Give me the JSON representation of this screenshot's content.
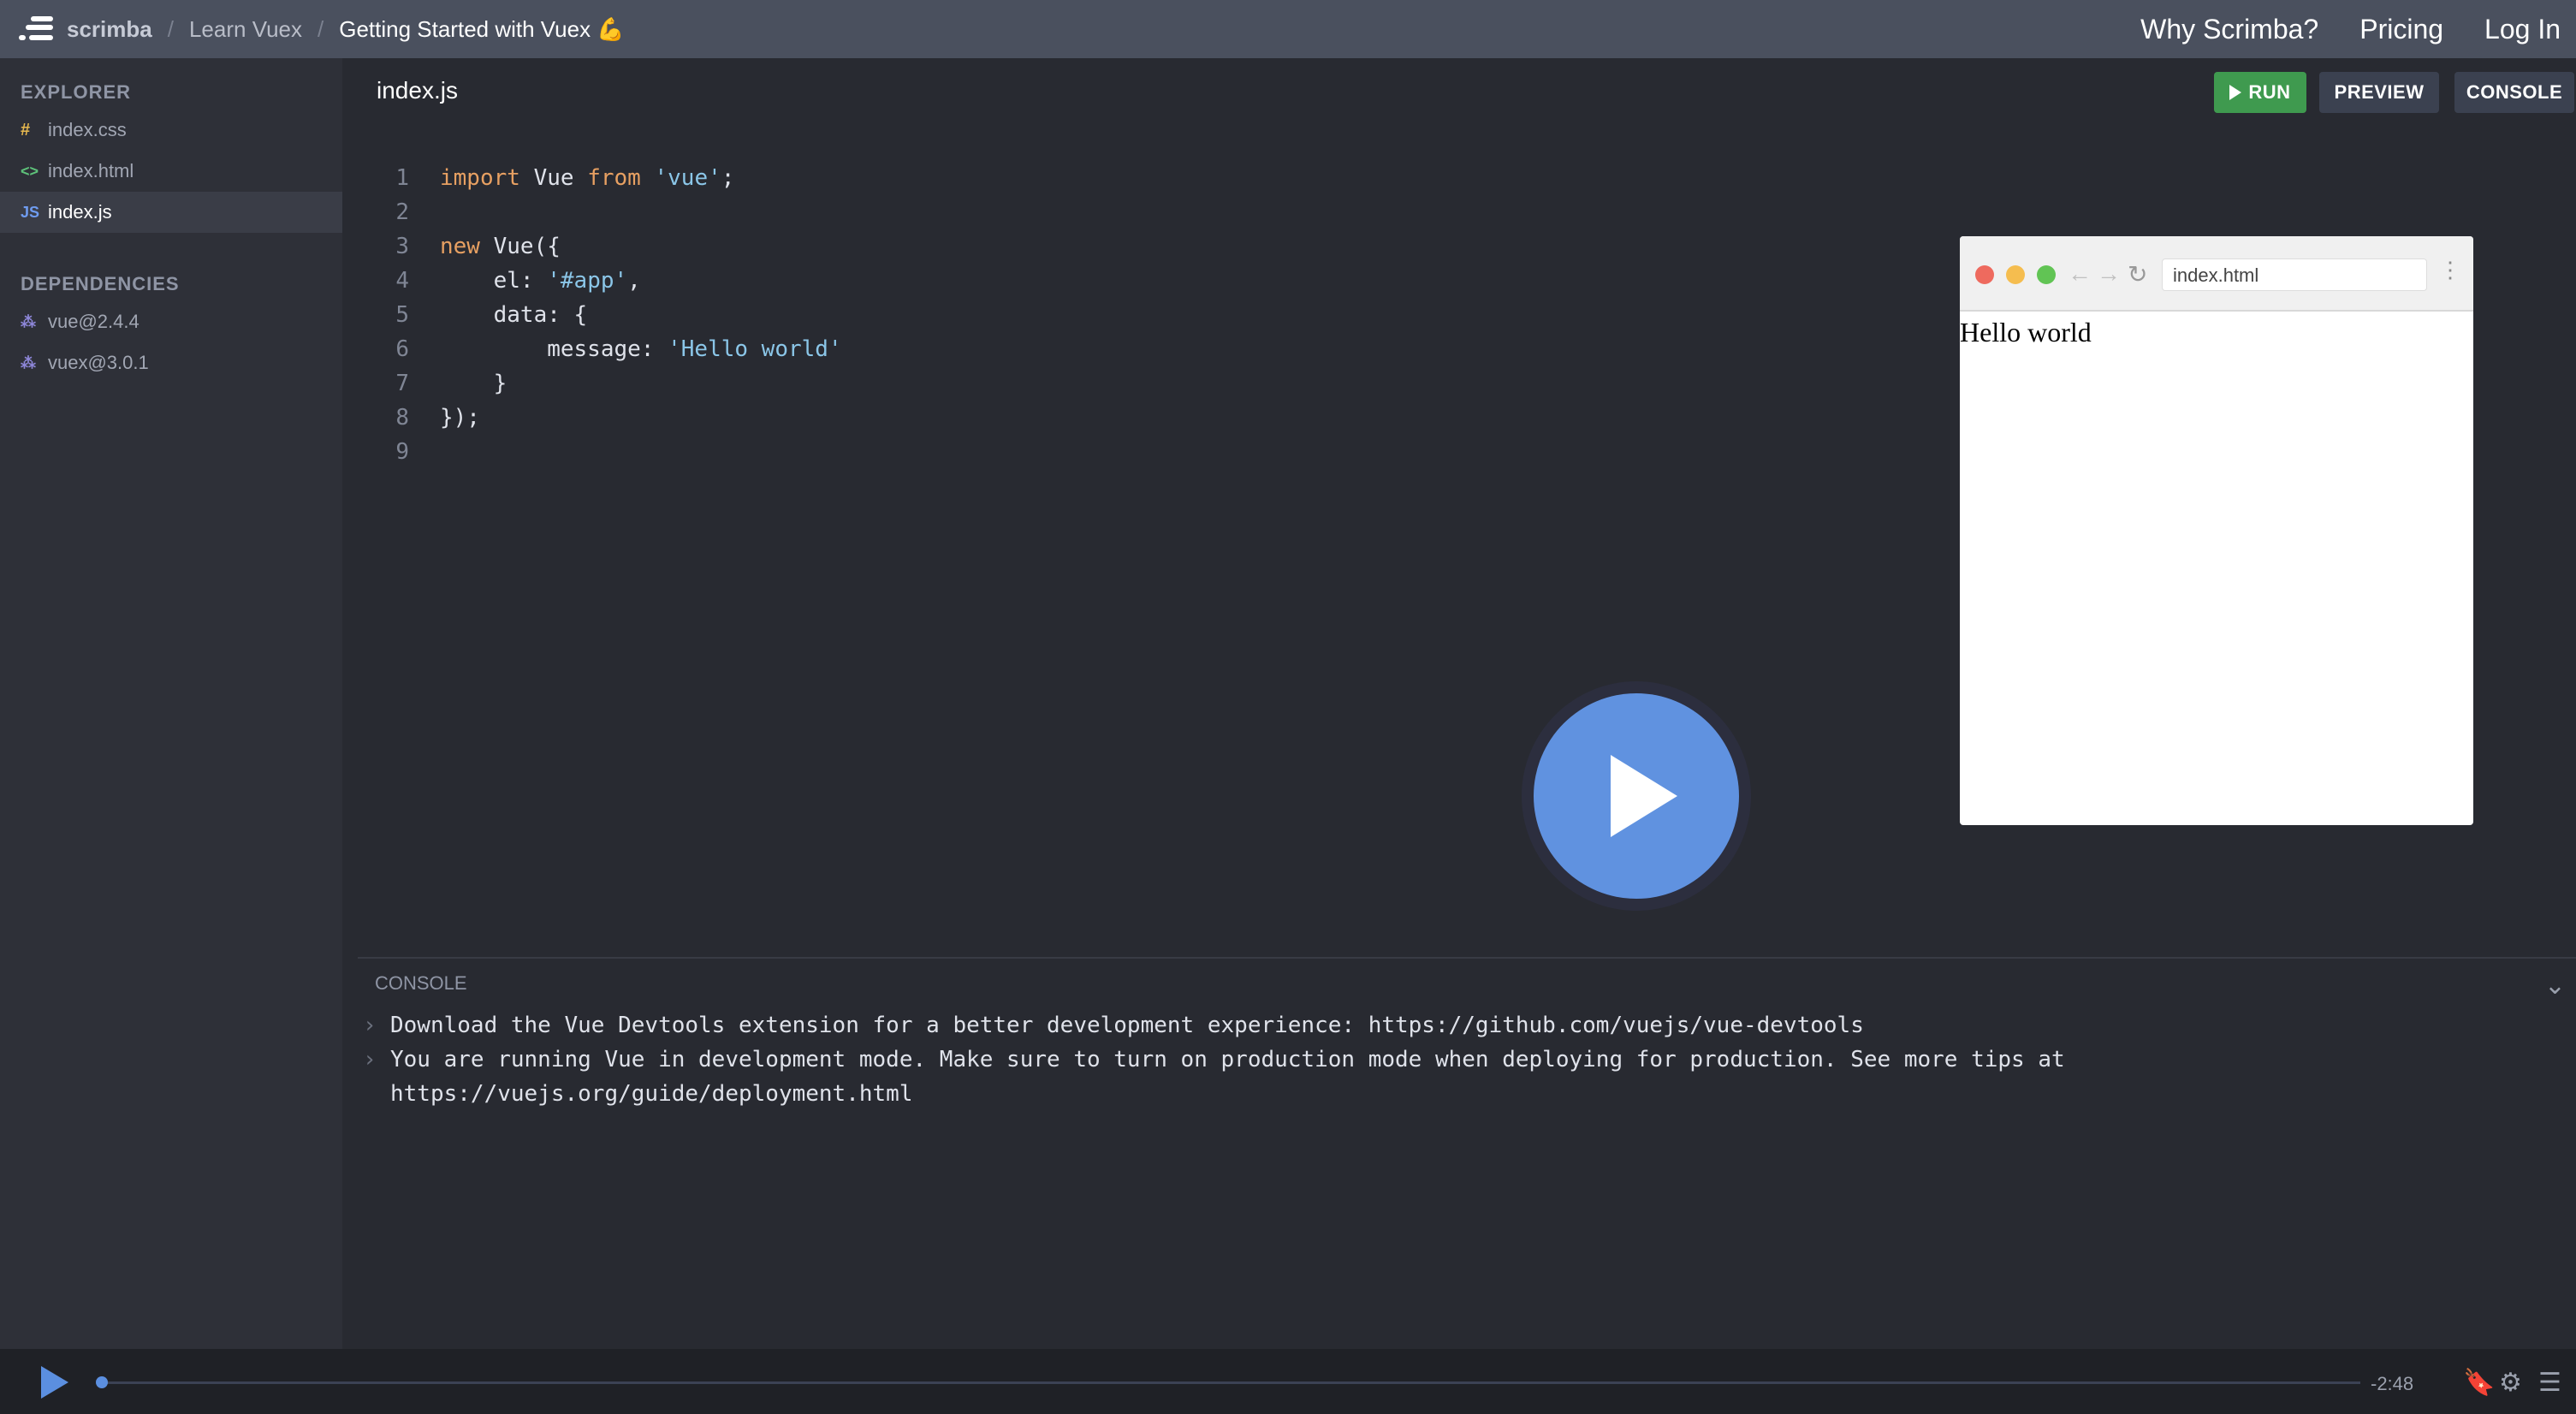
{
  "header": {
    "brand": "scrimba",
    "breadcrumbs": [
      "Learn Vuex",
      "Getting Started with Vuex 💪"
    ],
    "nav": [
      "Why Scrimba?",
      "Pricing",
      "Log In"
    ]
  },
  "sidebar": {
    "explorer_title": "EXPLORER",
    "files": [
      {
        "icon": "#",
        "name": "index.css"
      },
      {
        "icon": "<>",
        "name": "index.html"
      },
      {
        "icon": "JS",
        "name": "index.js"
      }
    ],
    "dependencies_title": "DEPENDENCIES",
    "dependencies": [
      "vue@2.4.4",
      "vuex@3.0.1"
    ]
  },
  "editor": {
    "active_file": "index.js",
    "buttons": {
      "run": "RUN",
      "preview": "PREVIEW",
      "console": "CONSOLE"
    },
    "line_numbers": [
      "1",
      "2",
      "3",
      "4",
      "5",
      "6",
      "7",
      "8",
      "9"
    ]
  },
  "preview": {
    "url": "index.html",
    "content": "Hello world"
  },
  "console": {
    "title": "CONSOLE",
    "lines": [
      "Download the Vue Devtools extension for a better development experience: https://github.com/vuejs/vue-devtools",
      "You are running Vue in development mode. Make sure to turn on production mode when deploying for production. See more tips at",
      "https://vuejs.org/guide/deployment.html"
    ]
  },
  "player": {
    "time_remaining": "-2:48",
    "progress": 0.0,
    "icons": [
      "play-icon",
      "bookmark-icon",
      "settings-icon",
      "menu-icon"
    ]
  },
  "colors": {
    "topbar": "#4a505e",
    "sidebar": "#2e3038",
    "editor": "#282a31",
    "run_green": "#3f9a4f",
    "accent_blue": "#6092e0"
  }
}
